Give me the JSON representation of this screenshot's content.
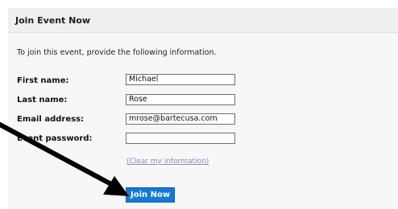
{
  "panel": {
    "title": "Join Event Now",
    "intro": "To join this event, provide the following information."
  },
  "form": {
    "first_name_label": "First name:",
    "first_name_value": "Michael",
    "last_name_label": "Last name:",
    "last_name_value": "Rose",
    "email_label": "Email address:",
    "email_value": "mrose@bartecusa.com",
    "password_label": "Event password:",
    "password_value": "",
    "clear_link": "(Clear my information)",
    "submit_label": "Join Now"
  },
  "colors": {
    "button_bg": "#1579d6",
    "link": "#8a8ab5",
    "arrow": "#000000"
  },
  "icons": {
    "annotation": "arrow-pointer-icon"
  }
}
